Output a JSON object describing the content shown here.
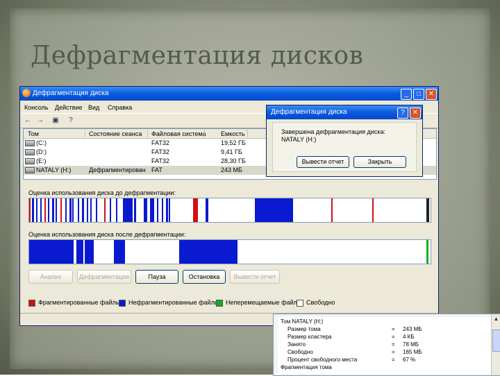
{
  "slide": {
    "title": "Дефрагментация дисков"
  },
  "window": {
    "title": "Дефрагментация диска",
    "menu": [
      "Консоль",
      "Действие",
      "Вид",
      "Справка"
    ],
    "columns": [
      "Том",
      "Состояние сеанса",
      "Файловая система",
      "Емкость"
    ],
    "volumes": [
      {
        "name": "(C:)",
        "state": "",
        "fs": "FAT32",
        "capacity": "19,52 ГБ"
      },
      {
        "name": "(D:)",
        "state": "",
        "fs": "FAT32",
        "capacity": "9,41 ГБ"
      },
      {
        "name": "(E:)",
        "state": "",
        "fs": "FAT32",
        "capacity": "28,30 ГБ"
      },
      {
        "name": "NATALY (H:)",
        "state": "Дефрагментирован",
        "fs": "FAT",
        "capacity": "243 МБ"
      }
    ],
    "before_label": "Оценка использования диска до дефрагментации:",
    "after_label": "Оценка использования диска после дефрагментации:",
    "buttons": {
      "analyze": "Анализ",
      "defrag": "Дефрагментация",
      "pause": "Пауза",
      "stop": "Остановка",
      "report": "Вывести отчет"
    },
    "legend": {
      "fragmented": "Фрагментированные файлы",
      "contiguous": "Нефрагментированные файлы",
      "unmovable": "Неперемещаемые файлы",
      "free": "Свободно"
    },
    "colors": {
      "fragmented": "#d01010",
      "contiguous": "#0a1ad0",
      "unmovable": "#10b020",
      "free": "#ffffff"
    }
  },
  "dialog": {
    "title": "Дефрагментация диска",
    "message_line1": "Завершена дефрагментация диска:",
    "message_line2": "NATALY (H:)",
    "report_button": "Вывести отчет",
    "close_button": "Закрыть"
  },
  "report": {
    "rows": [
      {
        "label": "Том NATALY (H:)",
        "sep": "",
        "value": ""
      },
      {
        "label": "Размер тома",
        "sep": "=",
        "value": "243 МБ"
      },
      {
        "label": "Размер кластера",
        "sep": "=",
        "value": "4 КБ"
      },
      {
        "label": "Занято",
        "sep": "=",
        "value": "78 МБ"
      },
      {
        "label": "Свободно",
        "sep": "=",
        "value": "165 МБ"
      },
      {
        "label": "Процент свободного места",
        "sep": "=",
        "value": "67 %"
      },
      {
        "label": "Фрагментация тома",
        "sep": "",
        "value": ""
      }
    ]
  }
}
